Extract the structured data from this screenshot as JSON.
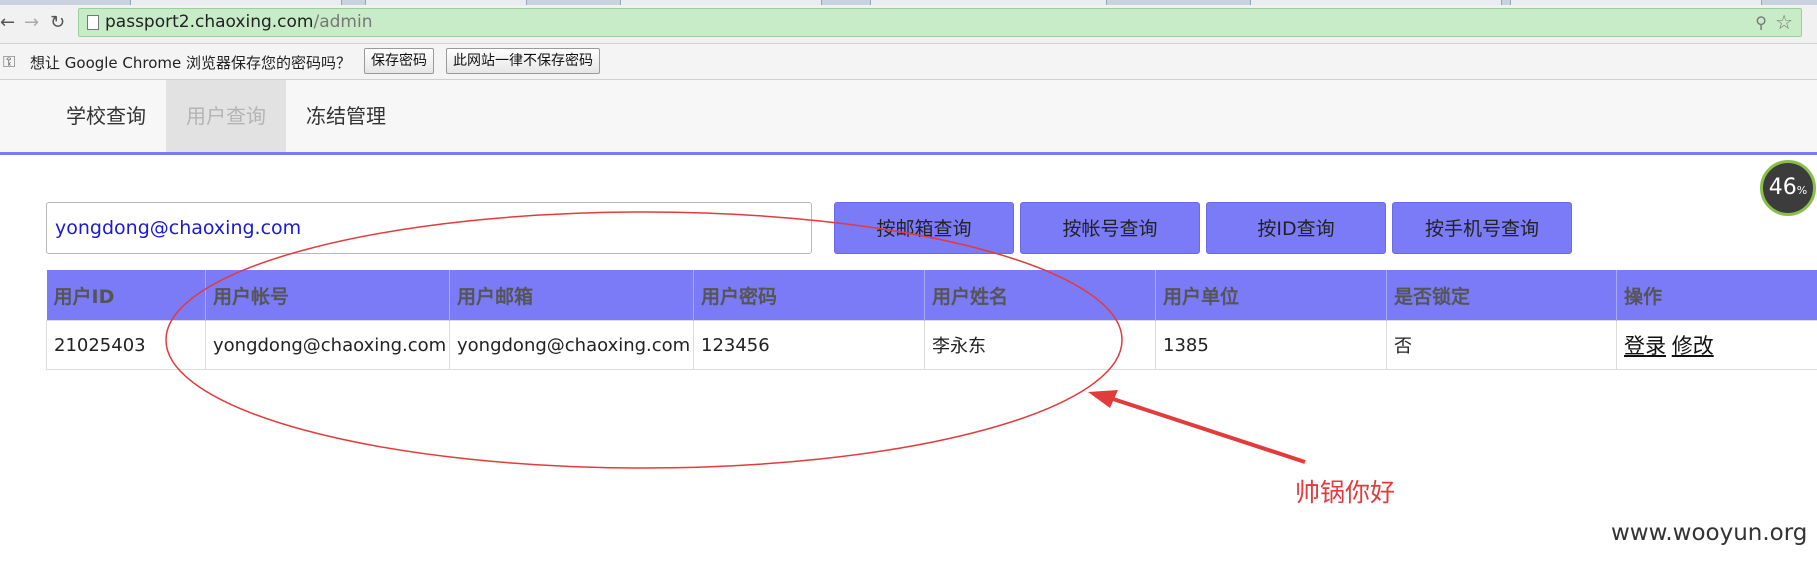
{
  "browser": {
    "url_host": "passport2.chaoxing.com",
    "url_path": "/admin",
    "password_prompt": "想让 Google Chrome 浏览器保存您的密码吗？",
    "save_password_label": "保存密码",
    "never_save_label": "此网站一律不保存密码",
    "icons": [
      "back-icon",
      "forward-icon",
      "reload-icon",
      "page-icon",
      "zoom-icon",
      "star-icon",
      "key-icon"
    ]
  },
  "nav": {
    "items": [
      {
        "label": "学校查询"
      },
      {
        "label": "用户查询",
        "active": true
      },
      {
        "label": "冻结管理"
      }
    ]
  },
  "search": {
    "value": "yongdong@chaoxing.com",
    "buttons": [
      "按邮箱查询",
      "按帐号查询",
      "按ID查询",
      "按手机号查询"
    ]
  },
  "table": {
    "headers": [
      "用户ID",
      "用户帐号",
      "用户邮箱",
      "用户密码",
      "用户姓名",
      "用户单位",
      "是否锁定",
      "操作"
    ],
    "rows": [
      {
        "cells": [
          "21025403",
          "yongdong@chaoxing.com",
          "yongdong@chaoxing.com",
          "123456",
          "李永东",
          "1385",
          "否"
        ],
        "actions": [
          "登录",
          "修改"
        ]
      }
    ]
  },
  "gauge": {
    "value": "46",
    "unit": "%"
  },
  "annotation": {
    "text": "帅锅你好",
    "color": "#e23b3b"
  },
  "watermark": "www.wooyun.org",
  "colors": {
    "accent": "#7b7bf7",
    "omnibox": "#c8ecc8",
    "annotation": "#e23b3b"
  }
}
